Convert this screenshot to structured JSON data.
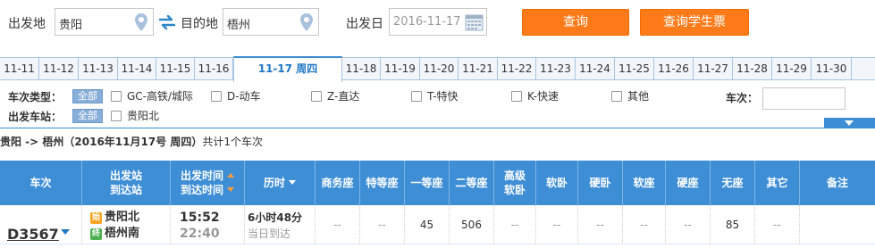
{
  "search": {
    "from_label": "出发地",
    "from_value": "贵阳",
    "to_label": "目的地",
    "to_value": "梧州",
    "date_label": "出发日",
    "date_value": "2016-11-17",
    "query_button": "查询",
    "student_button": "查询学生票"
  },
  "date_tabs": [
    "11-11",
    "11-12",
    "11-13",
    "11-14",
    "11-15",
    "11-16",
    "11-17 周四",
    "11-18",
    "11-19",
    "11-20",
    "11-21",
    "11-22",
    "11-23",
    "11-24",
    "11-25",
    "11-26",
    "11-27",
    "11-28",
    "11-29",
    "11-30"
  ],
  "active_tab": "11-17 周四",
  "filters": {
    "type_label": "车次类型：",
    "station_label": "出发车站：",
    "all_label": "全部",
    "types": [
      "GC-高铁/城际",
      "D-动车",
      "Z-直达",
      "T-特快",
      "K-快速",
      "其他"
    ],
    "stations": [
      "贵阳北"
    ],
    "train_no_label": "车次："
  },
  "summary": {
    "route": "贵阳 -> 梧州（2016年11月17号  周四）",
    "prefix": "共计",
    "count": "1",
    "suffix": "个车次"
  },
  "table": {
    "headers": {
      "train": "车次",
      "station_1": "出发站",
      "station_2": "到达站",
      "time_1": "出发时间",
      "time_2": "到达时间",
      "duration": "历时",
      "business": "商务座",
      "special": "特等座",
      "first": "一等座",
      "second": "二等座",
      "soft_sleeper_high_1": "高级",
      "soft_sleeper_high_2": "软卧",
      "soft_sleeper": "软卧",
      "hard_sleeper": "硬卧",
      "soft_seat": "软座",
      "hard_seat": "硬座",
      "no_seat": "无座",
      "other": "其它",
      "remark": "备注"
    },
    "rows": [
      {
        "train_no": "D3567",
        "from_badge": "始",
        "from_station": "贵阳北",
        "to_badge": "终",
        "to_station": "梧州南",
        "depart": "15:52",
        "arrive": "22:40",
        "duration": "6小时48分",
        "arrive_note": "当日到达",
        "business": "--",
        "special": "--",
        "first": "45",
        "second": "506",
        "high_soft_sleeper": "--",
        "soft_sleeper": "--",
        "hard_sleeper": "--",
        "soft_seat": "--",
        "hard_seat": "--",
        "no_seat": "85",
        "other": "--",
        "remark": ""
      }
    ]
  },
  "colors": {
    "accent_orange": "#ff7b1a",
    "header_blue": "#3e8ed6",
    "link_blue": "#1f77c5"
  }
}
